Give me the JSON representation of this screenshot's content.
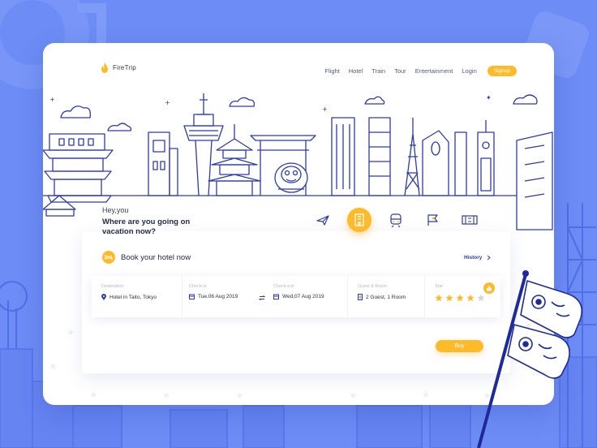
{
  "colors": {
    "background": "#6d8cf5",
    "accent": "#ffba2a",
    "line": "#2e3aa8",
    "card": "#ffffff"
  },
  "brand": {
    "name": "FireTrip",
    "icon": "flame-icon"
  },
  "nav": {
    "items": [
      "Flight",
      "Hotel",
      "Train",
      "Tour",
      "Entertainment",
      "Login"
    ],
    "signup": "Signup"
  },
  "greeting": {
    "hey": "Hey,you",
    "question": "Where are you going on vacation now?"
  },
  "categories": [
    {
      "icon": "plane-icon",
      "active": false
    },
    {
      "icon": "hotel-icon",
      "active": true
    },
    {
      "icon": "train-icon",
      "active": false
    },
    {
      "icon": "tour-flag-icon",
      "active": false
    },
    {
      "icon": "ticket-icon",
      "active": false
    }
  ],
  "booking": {
    "title": "Book your hotel now",
    "history": "History",
    "fields": {
      "destination": {
        "label": "Destination",
        "value": "Hotel in Taito, Tokyo"
      },
      "checkin": {
        "label": "Check-in",
        "value": "Tue,06 Aug 2019"
      },
      "checkout": {
        "label": "Check-out",
        "value": "Wed,07 Aug 2019"
      },
      "guests": {
        "label": "Guest & Room",
        "value": "2 Guest, 1 Room"
      },
      "star": {
        "label": "Star",
        "rating": 4,
        "max": 5
      }
    },
    "buy": "Buy"
  }
}
